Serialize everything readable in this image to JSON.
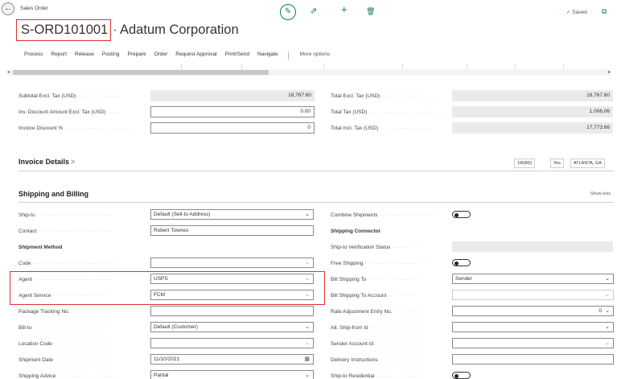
{
  "header": {
    "breadcrumb": "Sales Order",
    "order_no": "S-ORD101001",
    "separator": "·",
    "customer_name": "Adatum Corporation",
    "saved_label": "Saved"
  },
  "icons": {
    "back": "←",
    "edit": "✎",
    "share": "⇗",
    "add": "+",
    "delete": "🗑",
    "check": "✓",
    "popout": "⧉",
    "chevron_down": "⌄",
    "calendar": "▦",
    "left_arrow": "◂",
    "right_arrow": "▸"
  },
  "menu": {
    "items": [
      "Process",
      "Report",
      "Release",
      "Posting",
      "Prepare",
      "Order",
      "Request Approval",
      "Print/Send",
      "Navigate"
    ],
    "more": "More options"
  },
  "totals": {
    "left": [
      {
        "label": "Subtotal Excl. Tax (USD)",
        "value": "16,767.60",
        "editable": false
      },
      {
        "label": "Inv. Discount Amount Excl. Tax (USD)",
        "value": "0.00",
        "editable": true
      },
      {
        "label": "Invoice Discount %",
        "value": "0",
        "editable": true
      }
    ],
    "right": [
      {
        "label": "Total Excl. Tax (USD)",
        "value": "16,767.60"
      },
      {
        "label": "Total Tax (USD)",
        "value": "1,006.06"
      },
      {
        "label": "Total Incl. Tax (USD)",
        "value": "17,773.66"
      }
    ]
  },
  "invoice_details": {
    "title": "Invoice Details",
    "chevron": ">",
    "tags": [
      "1M(8D)",
      "Yes",
      "ATLANTA, GA"
    ]
  },
  "shipping": {
    "title": "Shipping and Billing",
    "show_less": "Show less",
    "left": {
      "ship_to_label": "Ship-to",
      "ship_to_value": "Default (Sell-to Address)",
      "contact_label": "Contact",
      "contact_value": "Robert Townes",
      "shipment_method_label": "Shipment Method",
      "code_label": "Code",
      "code_value": "",
      "agent_label": "Agent",
      "agent_value": "USPS",
      "agent_service_label": "Agent Service",
      "agent_service_value": "FCM",
      "tracking_label": "Package Tracking No.",
      "tracking_value": "",
      "bill_to_label": "Bill-to",
      "bill_to_value": "Default (Customer)",
      "location_label": "Location Code",
      "location_value": "",
      "shipment_date_label": "Shipment Date",
      "shipment_date_value": "11/10/2021",
      "shipping_advice_label": "Shipping Advice",
      "shipping_advice_value": "Partial"
    },
    "right": {
      "combine_label": "Combine Shipments",
      "connector_label": "Shipping Connector",
      "verification_label": "Ship-to Verification Status",
      "verification_value": "",
      "free_shipping_label": "Free Shipping",
      "bill_shipping_label": "Bill Shipping To",
      "bill_shipping_value": "Sender",
      "bill_account_label": "Bill Shipping To Account",
      "bill_account_value": "",
      "rate_adj_label": "Rate Adjustment Entry No.",
      "rate_adj_value": "0",
      "alt_from_label": "Alt. Ship-from Id",
      "alt_from_value": "",
      "sender_account_label": "Sender Account Id",
      "sender_account_value": "",
      "delivery_label": "Delivery Instructions",
      "delivery_value": "",
      "residential_label": "Ship-to Residential"
    }
  }
}
